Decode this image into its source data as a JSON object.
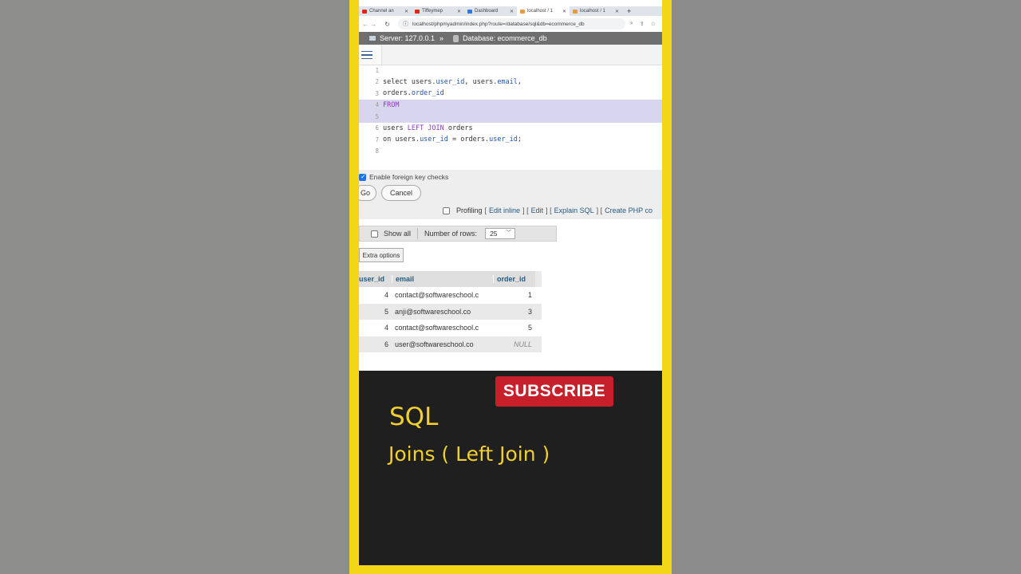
{
  "browser": {
    "tabs": [
      {
        "label": "Channel an",
        "fav_color": "#e62117"
      },
      {
        "label": "Tiffeymep",
        "fav_color": "#e62117"
      },
      {
        "label": "Dashboard",
        "fav_color": "#2a7ae2"
      },
      {
        "label": "localhost / 1",
        "fav_color": "#e89b3c"
      },
      {
        "label": "localhost / 1",
        "fav_color": "#e89b3c"
      }
    ],
    "new_tab": "+",
    "url": "localhost/phpmyadmin/index.php?route=/database/sql&db=ecommerce_db"
  },
  "breadcrumb": {
    "server": "Server: 127.0.0.1",
    "separator": "»",
    "database": "Database: ecommerce_db"
  },
  "editor": {
    "lines": [
      {
        "num": "1",
        "parts": []
      },
      {
        "num": "2",
        "parts": [
          [
            "select users.",
            ""
          ],
          [
            "user_id",
            "col"
          ],
          [
            ", users.",
            ""
          ],
          [
            "email",
            "col"
          ],
          [
            ",",
            ""
          ]
        ]
      },
      {
        "num": "3",
        "parts": [
          [
            "orders.",
            ""
          ],
          [
            "order_id",
            "col"
          ]
        ]
      },
      {
        "num": "4",
        "parts": [
          [
            "FROM",
            "kw"
          ]
        ]
      },
      {
        "num": "5",
        "parts": []
      },
      {
        "num": "6",
        "parts": [
          [
            "users ",
            ""
          ],
          [
            "LEFT JOIN",
            "kw"
          ],
          [
            " orders",
            ""
          ]
        ]
      },
      {
        "num": "7",
        "parts": [
          [
            "on users.",
            ""
          ],
          [
            "user_id",
            "col"
          ],
          [
            " = orders.",
            ""
          ],
          [
            "user_id",
            "col"
          ],
          [
            ";",
            ""
          ]
        ]
      },
      {
        "num": "8",
        "parts": []
      }
    ]
  },
  "options": {
    "foreign_key_label": "Enable foreign key checks",
    "go_label": "Go",
    "cancel_label": "Cancel",
    "profiling_label": "Profiling",
    "edit_inline": "Edit inline",
    "edit": "Edit",
    "explain_sql": "Explain SQL",
    "create_php": "Create PHP co"
  },
  "results_nav": {
    "show_all": "Show all",
    "rows_label": "Number of rows:",
    "rows_value": "25",
    "extra_options": "Extra options"
  },
  "results": {
    "headers": [
      "user_id",
      "email",
      "order_id"
    ],
    "rows": [
      [
        "4",
        "contact@softwareschool.c",
        "1"
      ],
      [
        "5",
        "anji@softwareschool.co",
        "3"
      ],
      [
        "4",
        "contact@softwareschool.c",
        "5"
      ],
      [
        "6",
        "user@softwareschool.co",
        "NULL"
      ]
    ]
  },
  "overlay": {
    "subscribe": "SUBSCRIBE",
    "title": "SQL",
    "subtitle": "Joins ( Left Join )"
  }
}
